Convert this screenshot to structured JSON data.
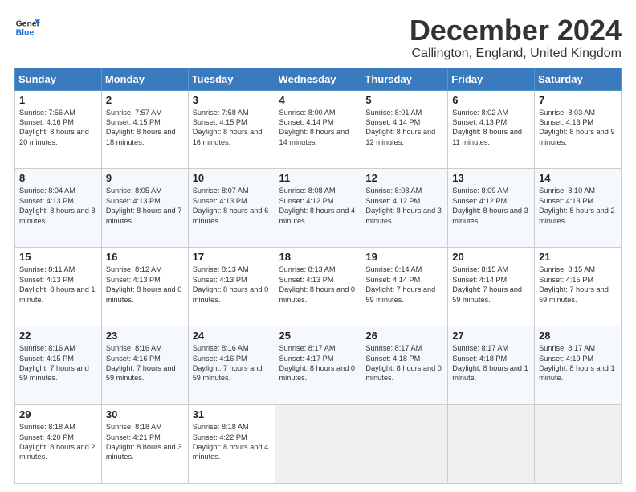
{
  "header": {
    "logo_line1": "General",
    "logo_line2": "Blue",
    "month_title": "December 2024",
    "location": "Callington, England, United Kingdom"
  },
  "days_of_week": [
    "Sunday",
    "Monday",
    "Tuesday",
    "Wednesday",
    "Thursday",
    "Friday",
    "Saturday"
  ],
  "weeks": [
    [
      {
        "day": "1",
        "sunrise": "Sunrise: 7:56 AM",
        "sunset": "Sunset: 4:16 PM",
        "daylight": "Daylight: 8 hours and 20 minutes."
      },
      {
        "day": "2",
        "sunrise": "Sunrise: 7:57 AM",
        "sunset": "Sunset: 4:15 PM",
        "daylight": "Daylight: 8 hours and 18 minutes."
      },
      {
        "day": "3",
        "sunrise": "Sunrise: 7:58 AM",
        "sunset": "Sunset: 4:15 PM",
        "daylight": "Daylight: 8 hours and 16 minutes."
      },
      {
        "day": "4",
        "sunrise": "Sunrise: 8:00 AM",
        "sunset": "Sunset: 4:14 PM",
        "daylight": "Daylight: 8 hours and 14 minutes."
      },
      {
        "day": "5",
        "sunrise": "Sunrise: 8:01 AM",
        "sunset": "Sunset: 4:14 PM",
        "daylight": "Daylight: 8 hours and 12 minutes."
      },
      {
        "day": "6",
        "sunrise": "Sunrise: 8:02 AM",
        "sunset": "Sunset: 4:13 PM",
        "daylight": "Daylight: 8 hours and 11 minutes."
      },
      {
        "day": "7",
        "sunrise": "Sunrise: 8:03 AM",
        "sunset": "Sunset: 4:13 PM",
        "daylight": "Daylight: 8 hours and 9 minutes."
      }
    ],
    [
      {
        "day": "8",
        "sunrise": "Sunrise: 8:04 AM",
        "sunset": "Sunset: 4:13 PM",
        "daylight": "Daylight: 8 hours and 8 minutes."
      },
      {
        "day": "9",
        "sunrise": "Sunrise: 8:05 AM",
        "sunset": "Sunset: 4:13 PM",
        "daylight": "Daylight: 8 hours and 7 minutes."
      },
      {
        "day": "10",
        "sunrise": "Sunrise: 8:07 AM",
        "sunset": "Sunset: 4:13 PM",
        "daylight": "Daylight: 8 hours and 6 minutes."
      },
      {
        "day": "11",
        "sunrise": "Sunrise: 8:08 AM",
        "sunset": "Sunset: 4:12 PM",
        "daylight": "Daylight: 8 hours and 4 minutes."
      },
      {
        "day": "12",
        "sunrise": "Sunrise: 8:08 AM",
        "sunset": "Sunset: 4:12 PM",
        "daylight": "Daylight: 8 hours and 3 minutes."
      },
      {
        "day": "13",
        "sunrise": "Sunrise: 8:09 AM",
        "sunset": "Sunset: 4:12 PM",
        "daylight": "Daylight: 8 hours and 3 minutes."
      },
      {
        "day": "14",
        "sunrise": "Sunrise: 8:10 AM",
        "sunset": "Sunset: 4:13 PM",
        "daylight": "Daylight: 8 hours and 2 minutes."
      }
    ],
    [
      {
        "day": "15",
        "sunrise": "Sunrise: 8:11 AM",
        "sunset": "Sunset: 4:13 PM",
        "daylight": "Daylight: 8 hours and 1 minute."
      },
      {
        "day": "16",
        "sunrise": "Sunrise: 8:12 AM",
        "sunset": "Sunset: 4:13 PM",
        "daylight": "Daylight: 8 hours and 0 minutes."
      },
      {
        "day": "17",
        "sunrise": "Sunrise: 8:13 AM",
        "sunset": "Sunset: 4:13 PM",
        "daylight": "Daylight: 8 hours and 0 minutes."
      },
      {
        "day": "18",
        "sunrise": "Sunrise: 8:13 AM",
        "sunset": "Sunset: 4:13 PM",
        "daylight": "Daylight: 8 hours and 0 minutes."
      },
      {
        "day": "19",
        "sunrise": "Sunrise: 8:14 AM",
        "sunset": "Sunset: 4:14 PM",
        "daylight": "Daylight: 7 hours and 59 minutes."
      },
      {
        "day": "20",
        "sunrise": "Sunrise: 8:15 AM",
        "sunset": "Sunset: 4:14 PM",
        "daylight": "Daylight: 7 hours and 59 minutes."
      },
      {
        "day": "21",
        "sunrise": "Sunrise: 8:15 AM",
        "sunset": "Sunset: 4:15 PM",
        "daylight": "Daylight: 7 hours and 59 minutes."
      }
    ],
    [
      {
        "day": "22",
        "sunrise": "Sunrise: 8:16 AM",
        "sunset": "Sunset: 4:15 PM",
        "daylight": "Daylight: 7 hours and 59 minutes."
      },
      {
        "day": "23",
        "sunrise": "Sunrise: 8:16 AM",
        "sunset": "Sunset: 4:16 PM",
        "daylight": "Daylight: 7 hours and 59 minutes."
      },
      {
        "day": "24",
        "sunrise": "Sunrise: 8:16 AM",
        "sunset": "Sunset: 4:16 PM",
        "daylight": "Daylight: 7 hours and 59 minutes."
      },
      {
        "day": "25",
        "sunrise": "Sunrise: 8:17 AM",
        "sunset": "Sunset: 4:17 PM",
        "daylight": "Daylight: 8 hours and 0 minutes."
      },
      {
        "day": "26",
        "sunrise": "Sunrise: 8:17 AM",
        "sunset": "Sunset: 4:18 PM",
        "daylight": "Daylight: 8 hours and 0 minutes."
      },
      {
        "day": "27",
        "sunrise": "Sunrise: 8:17 AM",
        "sunset": "Sunset: 4:18 PM",
        "daylight": "Daylight: 8 hours and 1 minute."
      },
      {
        "day": "28",
        "sunrise": "Sunrise: 8:17 AM",
        "sunset": "Sunset: 4:19 PM",
        "daylight": "Daylight: 8 hours and 1 minute."
      }
    ],
    [
      {
        "day": "29",
        "sunrise": "Sunrise: 8:18 AM",
        "sunset": "Sunset: 4:20 PM",
        "daylight": "Daylight: 8 hours and 2 minutes."
      },
      {
        "day": "30",
        "sunrise": "Sunrise: 8:18 AM",
        "sunset": "Sunset: 4:21 PM",
        "daylight": "Daylight: 8 hours and 3 minutes."
      },
      {
        "day": "31",
        "sunrise": "Sunrise: 8:18 AM",
        "sunset": "Sunset: 4:22 PM",
        "daylight": "Daylight: 8 hours and 4 minutes."
      },
      null,
      null,
      null,
      null
    ]
  ]
}
